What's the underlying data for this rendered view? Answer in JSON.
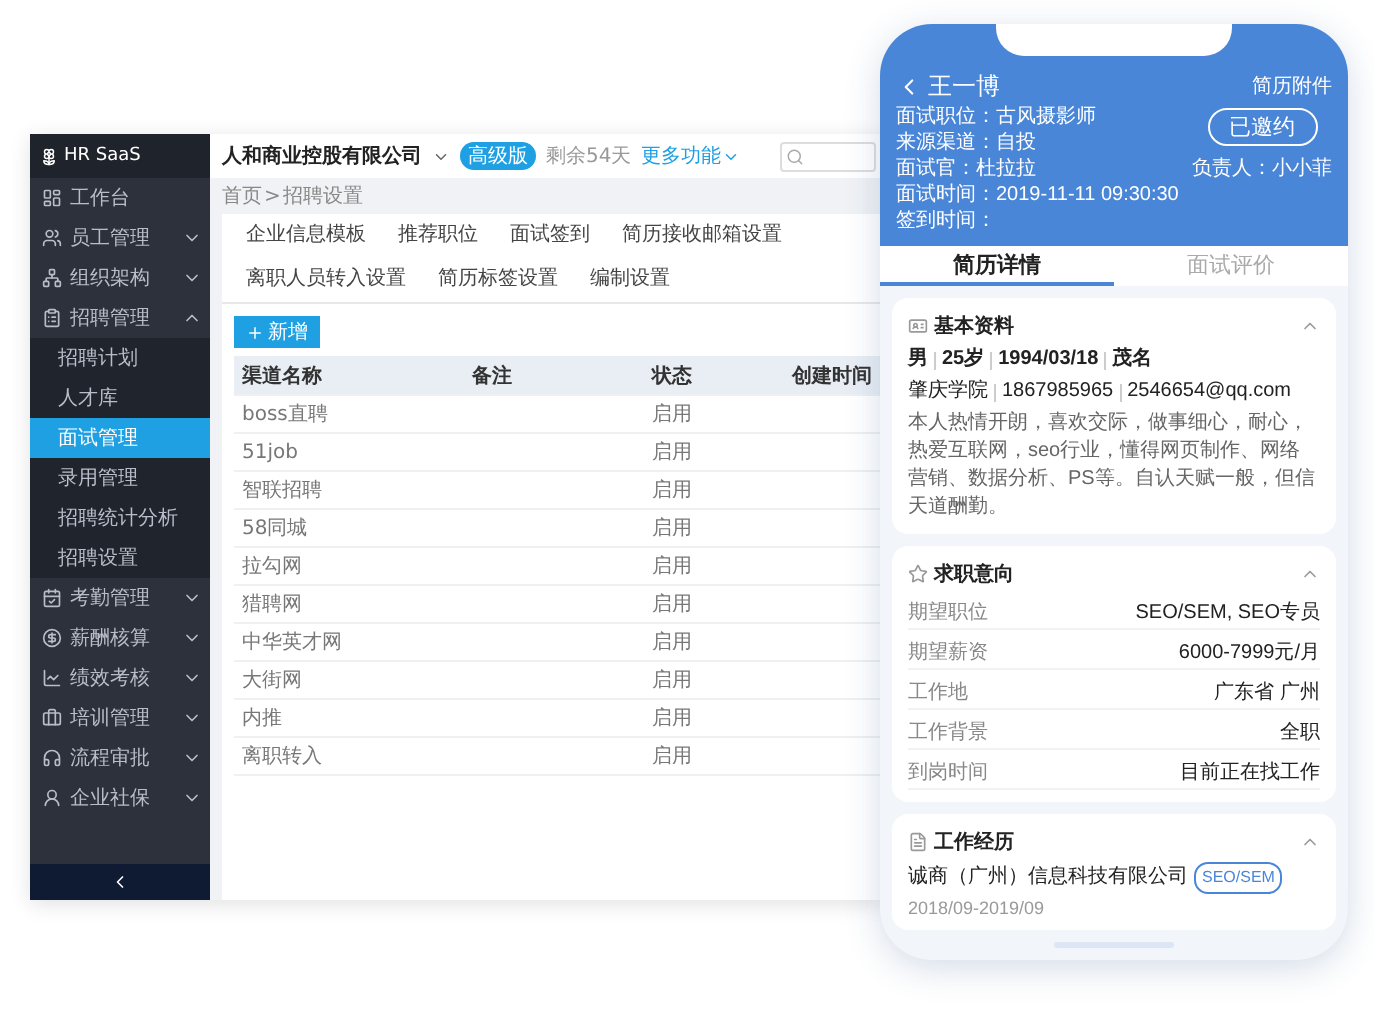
{
  "desktop": {
    "sidebar": {
      "logo": "HR SaaS",
      "items": [
        {
          "label": "工作台"
        },
        {
          "label": "员工管理",
          "expanded": false
        },
        {
          "label": "组织架构",
          "expanded": false
        },
        {
          "label": "招聘管理",
          "expanded": true,
          "children": [
            {
              "label": "招聘计划",
              "selected": false
            },
            {
              "label": "人才库",
              "selected": false
            },
            {
              "label": "面试管理",
              "selected": true
            },
            {
              "label": "录用管理",
              "selected": false
            },
            {
              "label": "招聘统计分析",
              "selected": false
            },
            {
              "label": "招聘设置",
              "selected": false
            }
          ]
        },
        {
          "label": "考勤管理",
          "expanded": false
        },
        {
          "label": "薪酬核算",
          "expanded": false
        },
        {
          "label": "绩效考核",
          "expanded": false
        },
        {
          "label": "培训管理",
          "expanded": false
        },
        {
          "label": "流程审批",
          "expanded": false
        },
        {
          "label": "企业社保",
          "expanded": false
        }
      ]
    },
    "header": {
      "company": "人和商业控股有限公司",
      "badge": "高级版",
      "remaining": "剩余54天",
      "more": "更多功能"
    },
    "breadcrumb": {
      "items": [
        "首页",
        "招聘设置"
      ],
      "separator": ">"
    },
    "tabs": [
      {
        "label": "企业信息模板",
        "selected": false
      },
      {
        "label": "推荐职位",
        "selected": false
      },
      {
        "label": "面试签到",
        "selected": false
      },
      {
        "label": "简历接收邮箱设置",
        "selected": false
      },
      {
        "label": "离职人员转入设置",
        "selected": false
      },
      {
        "label": "简历标签设置",
        "selected": false
      },
      {
        "label": "编制设置",
        "selected": false
      }
    ],
    "add_button": "新增",
    "table": {
      "columns": [
        "渠道名称",
        "备注",
        "状态",
        "创建时间"
      ],
      "rows": [
        {
          "name": "boss直聘",
          "status": "启用"
        },
        {
          "name": "51job",
          "status": "启用"
        },
        {
          "name": "智联招聘",
          "status": "启用"
        },
        {
          "name": "58同城",
          "status": "启用"
        },
        {
          "name": "拉勾网",
          "status": "启用"
        },
        {
          "name": "猎聘网",
          "status": "启用"
        },
        {
          "name": "中华英才网",
          "status": "启用"
        },
        {
          "name": "大街网",
          "status": "启用"
        },
        {
          "name": "内推",
          "status": "启用"
        },
        {
          "name": "离职转入",
          "status": "启用"
        }
      ]
    }
  },
  "phone": {
    "title": "王一博",
    "attachment": "简历附件",
    "info": [
      {
        "label": "面试职位：",
        "value": "古风摄影师"
      },
      {
        "label": "来源渠道：",
        "value": "自投"
      },
      {
        "label": "面试官：",
        "value": "杜拉拉"
      },
      {
        "label": "面试时间：",
        "value": "2019-11-11 09:30:30"
      },
      {
        "label": "签到时间："
      }
    ],
    "status": "已邀约",
    "owner": "负责人：小小菲",
    "tabs": [
      {
        "label": "简历详情",
        "selected": true
      },
      {
        "label": "面试评价",
        "selected": false
      }
    ],
    "basic": {
      "title": "基本资料",
      "expanded": true,
      "line1": [
        "男",
        "25岁",
        "1994/03/18",
        "茂名"
      ],
      "line2": [
        "肇庆学院",
        "1867985965",
        "2546654@qq.com"
      ],
      "bio": "本人热情开朗，喜欢交际，做事细心，耐心，热爱互联网，seo行业，懂得网页制作、网络营销、数据分析、PS等。自认天赋一般，但信天道酬勤。"
    },
    "intention": {
      "title": "求职意向",
      "expanded": true,
      "rows": [
        {
          "label": "期望职位",
          "value": "SEO/SEM, SEO专员"
        },
        {
          "label": "期望薪资",
          "value": "6000-7999元/月"
        },
        {
          "label": "工作地",
          "value": "广东省 广州"
        },
        {
          "label": "工作背景",
          "value": "全职"
        },
        {
          "label": "到岗时间",
          "value": "目前正在找工作"
        }
      ]
    },
    "experience": {
      "title": "工作经历",
      "expanded": true,
      "company": "诚商（广州）信息科技有限公司",
      "tag": "SEO/SEM",
      "period": "2018/09-2019/09"
    }
  }
}
